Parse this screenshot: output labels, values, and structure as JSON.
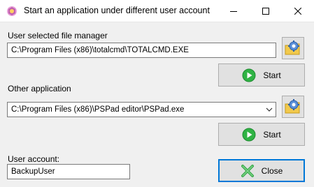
{
  "window": {
    "title": "Start an application under different user account"
  },
  "file_manager": {
    "label": "User selected file manager",
    "path": "C:\\Program Files (x86)\\totalcmd\\TOTALCMD.EXE",
    "start_label": "Start"
  },
  "other_app": {
    "label": "Other application",
    "path": "C:\\Program Files (x86)\\PSPad editor\\PSPad.exe",
    "start_label": "Start"
  },
  "user": {
    "label": "User account:",
    "value": "BackupUser"
  },
  "close_label": "Close",
  "colors": {
    "accent": "#0078d7",
    "start_green": "#2fb344",
    "close_green": "#3aa84a"
  }
}
